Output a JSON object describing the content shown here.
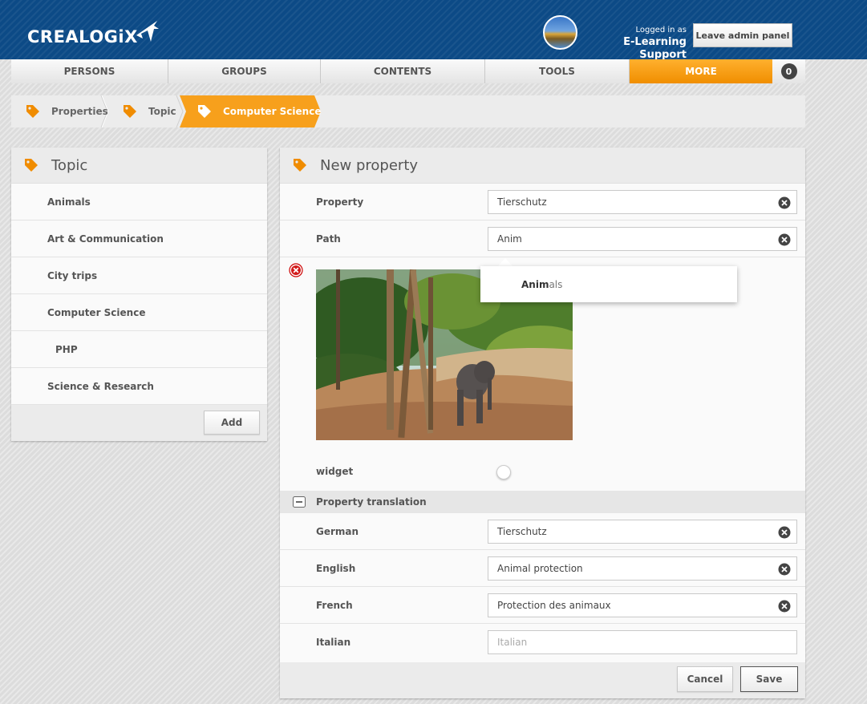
{
  "header": {
    "logo_text": "CREALOGiX",
    "login_label": "Logged in as",
    "login_user": "E-Learning Support",
    "leave_button": "Leave admin panel",
    "colors": {
      "header_bg": "#0c4a86",
      "accent": "#f7a01c"
    }
  },
  "nav": {
    "items": [
      {
        "label": "PERSONS"
      },
      {
        "label": "GROUPS"
      },
      {
        "label": "CONTENTS"
      },
      {
        "label": "TOOLS"
      },
      {
        "label": "MORE",
        "active": true
      }
    ],
    "notification_count": "0"
  },
  "breadcrumb": [
    {
      "label": "Properties",
      "icon": "tag-icon"
    },
    {
      "label": "Topic",
      "icon": "tag-icon"
    },
    {
      "label": "Computer Science",
      "icon": "tag-icon",
      "active": true
    }
  ],
  "left_panel": {
    "title": "Topic",
    "items": [
      {
        "label": "Animals"
      },
      {
        "label": "Art & Communication"
      },
      {
        "label": "City trips"
      },
      {
        "label": "Computer Science"
      },
      {
        "label": "PHP"
      },
      {
        "label": "Science & Research"
      }
    ],
    "add_button": "Add"
  },
  "form": {
    "title": "New property",
    "property": {
      "label": "Property",
      "value": "Tierschutz"
    },
    "path": {
      "label": "Path",
      "value": "Anim"
    },
    "autocomplete": {
      "match": "Anim",
      "rest": "als"
    },
    "image": {
      "alt": "elephant-photo"
    },
    "widget": {
      "label": "widget"
    },
    "translation_section": {
      "label": "Property translation"
    },
    "translations": {
      "german": {
        "label": "German",
        "value": "Tierschutz"
      },
      "english": {
        "label": "English",
        "value": "Animal protection"
      },
      "french": {
        "label": "French",
        "value": "Protection des animaux"
      },
      "italian": {
        "label": "Italian",
        "value": "",
        "placeholder": "Italian"
      }
    },
    "cancel_button": "Cancel",
    "save_button": "Save"
  }
}
